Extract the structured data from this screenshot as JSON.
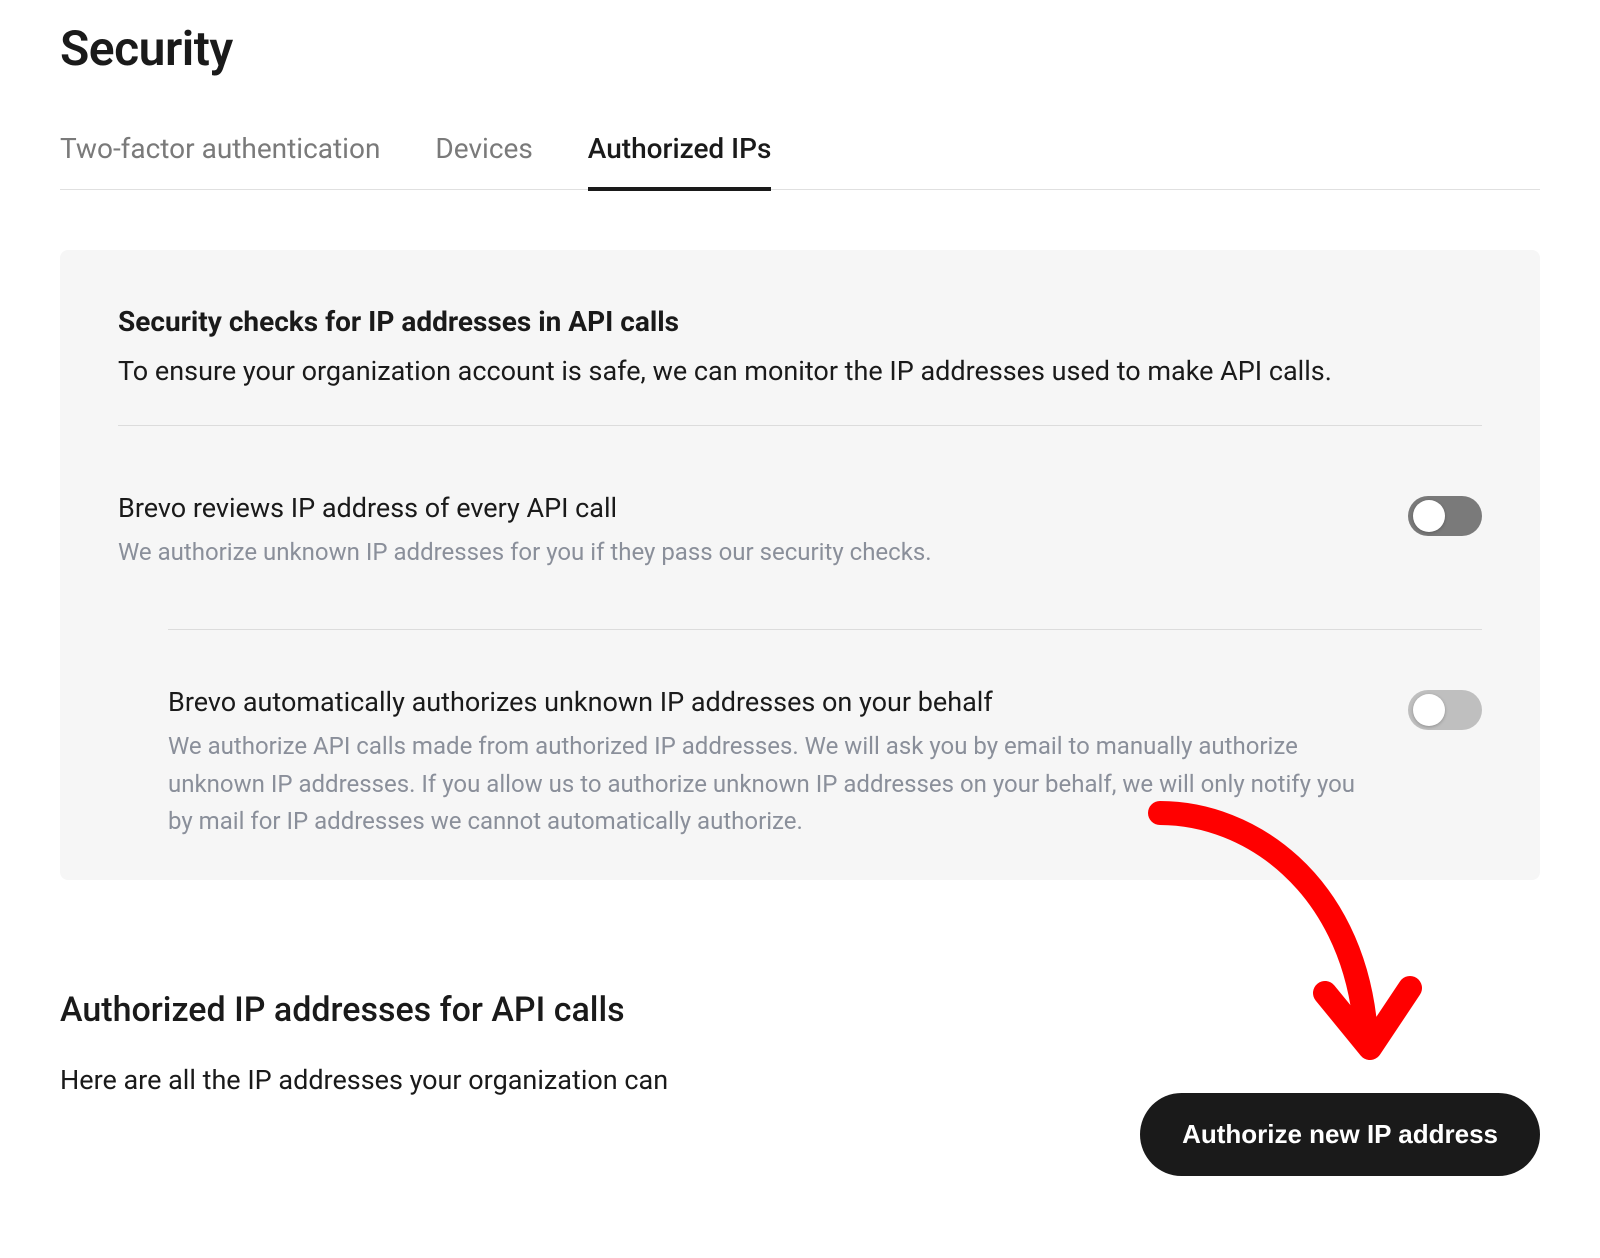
{
  "page": {
    "title": "Security"
  },
  "tabs": [
    {
      "label": "Two-factor authentication",
      "active": false
    },
    {
      "label": "Devices",
      "active": false
    },
    {
      "label": "Authorized IPs",
      "active": true
    }
  ],
  "card": {
    "title": "Security checks for IP addresses in API calls",
    "description": "To ensure your organization account is safe, we can monitor the IP addresses used to make API calls."
  },
  "option1": {
    "title": "Brevo reviews IP address of every API call",
    "sub": "We authorize unknown IP addresses for you if they pass our security checks.",
    "enabled": true
  },
  "option2": {
    "title": "Brevo automatically authorizes unknown IP addresses on your behalf",
    "sub": "We authorize API calls made from authorized IP addresses. We will ask you by email to manually authorize unknown IP addresses. If you allow us to authorize unknown IP addresses on your behalf, we will only notify you by mail for IP addresses we cannot automatically authorize.",
    "enabled": false
  },
  "section": {
    "heading": "Authorized IP addresses for API calls",
    "sub": "Here are all the IP addresses your organization can"
  },
  "button": {
    "authorize": "Authorize new IP address"
  }
}
